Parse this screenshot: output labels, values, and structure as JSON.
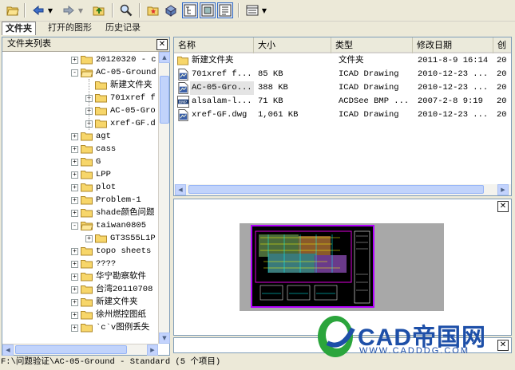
{
  "toolbar": {
    "buttons": [
      {
        "name": "open-folder-icon"
      },
      {
        "name": "back-arrow-icon"
      },
      {
        "name": "forward-arrow-icon"
      },
      {
        "name": "up-folder-icon"
      },
      {
        "name": "search-icon"
      },
      {
        "name": "favorites-folder-icon"
      },
      {
        "name": "load-icon"
      },
      {
        "name": "tree-toggle-icon"
      },
      {
        "name": "preview-toggle-icon"
      },
      {
        "name": "description-toggle-icon"
      },
      {
        "name": "views-icon"
      }
    ]
  },
  "tabs": [
    {
      "label": "文件夹",
      "active": true
    },
    {
      "label": "打开的图形",
      "active": false
    },
    {
      "label": "历史记录",
      "active": false
    }
  ],
  "left_pane": {
    "header": "文件夹列表",
    "tree": [
      {
        "label": "20120320 - c",
        "level": 1,
        "expander": "+"
      },
      {
        "label": "AC-05-Ground",
        "level": 1,
        "expander": "-",
        "open": true
      },
      {
        "label": "新建文件夹",
        "level": 2,
        "expander": ""
      },
      {
        "label": "701xref f",
        "level": 2,
        "expander": "+"
      },
      {
        "label": "AC-05-Gro",
        "level": 2,
        "expander": "+"
      },
      {
        "label": "xref-GF.d",
        "level": 2,
        "expander": "+"
      },
      {
        "label": "agt",
        "level": 1,
        "expander": "+"
      },
      {
        "label": "cass",
        "level": 1,
        "expander": "+"
      },
      {
        "label": "G",
        "level": 1,
        "expander": "+"
      },
      {
        "label": "LPP",
        "level": 1,
        "expander": "+"
      },
      {
        "label": "plot",
        "level": 1,
        "expander": "+"
      },
      {
        "label": "Problem-1",
        "level": 1,
        "expander": "+"
      },
      {
        "label": "shade颜色问题",
        "level": 1,
        "expander": "+"
      },
      {
        "label": "taiwan0805",
        "level": 1,
        "expander": "-",
        "open": true
      },
      {
        "label": "GT3S55L1P",
        "level": 2,
        "expander": "+"
      },
      {
        "label": "topo sheets",
        "level": 1,
        "expander": "+"
      },
      {
        "label": "????",
        "level": 1,
        "expander": "+"
      },
      {
        "label": "华宁勘察软件",
        "level": 1,
        "expander": "+"
      },
      {
        "label": "台湾20110708",
        "level": 1,
        "expander": "+"
      },
      {
        "label": "新建文件夹",
        "level": 1,
        "expander": "+"
      },
      {
        "label": "徐州燃控图纸",
        "level": 1,
        "expander": "+"
      },
      {
        "label": "`c`v图例丢失",
        "level": 1,
        "expander": "+"
      }
    ]
  },
  "file_list": {
    "columns": [
      "名称",
      "大小",
      "类型",
      "修改日期",
      "创建"
    ],
    "rows": [
      {
        "name": "新建文件夹",
        "size": "",
        "type": "文件夹",
        "modified": "2011-8-9 16:14",
        "created": "20",
        "icon": "folder-icon",
        "selected": false
      },
      {
        "name": "701xref f...",
        "size": "85 KB",
        "type": "ICAD Drawing",
        "modified": "2010-12-23 ...",
        "created": "20",
        "icon": "dwg-file-icon",
        "selected": false
      },
      {
        "name": "AC-05-Gro...",
        "size": "388 KB",
        "type": "ICAD Drawing",
        "modified": "2010-12-23 ...",
        "created": "20",
        "icon": "dwg-file-icon",
        "selected": true
      },
      {
        "name": "alsalam-l...",
        "size": "71 KB",
        "type": "ACDSee BMP ...",
        "modified": "2007-2-8 9:19",
        "created": "20",
        "icon": "bmp-file-icon",
        "selected": false
      },
      {
        "name": "xref-GF.dwg",
        "size": "1,061 KB",
        "type": "ICAD Drawing",
        "modified": "2010-12-23 ...",
        "created": "20",
        "icon": "dwg-file-icon",
        "selected": false
      }
    ]
  },
  "status": {
    "text": "F:\\问题验证\\AC-05-Ground - Standard  (5  个项目)"
  },
  "watermark": {
    "brand": "CAD帝国网",
    "url": "WWW.CADDDG.COM"
  },
  "colors": {
    "brand_blue": "#1d4fa8",
    "brand_green": "#2ba53c",
    "selection_gray": "#e4e4e4",
    "preview_border": "#b300ff"
  }
}
